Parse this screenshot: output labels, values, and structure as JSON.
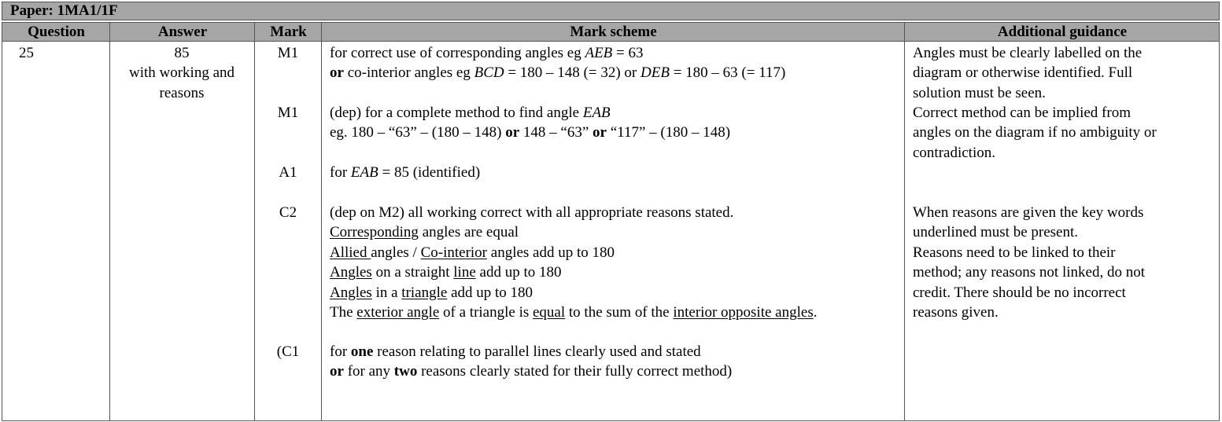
{
  "paper": {
    "label": "Paper: 1MA1/1F"
  },
  "headers": {
    "question": "Question",
    "answer": "Answer",
    "mark": "Mark",
    "mark_scheme": "Mark scheme",
    "additional_guidance": "Additional guidance"
  },
  "row": {
    "question": "25",
    "answer": [
      "85",
      "with working and",
      "reasons"
    ],
    "marks": {
      "m1a": "M1",
      "m1b": "M1",
      "a1": "A1",
      "c2": "C2",
      "c1": "(C1"
    },
    "scheme": {
      "m1a_line1_pre": "for correct use of corresponding angles eg ",
      "m1a_line1_var": "AEB",
      "m1a_line1_post": " = 63",
      "m1a_line2_bold": "or",
      "m1a_line2_a": " co-interior angles eg ",
      "m1a_line2_var1": "BCD",
      "m1a_line2_b": " = 180 – 148 (= 32) or ",
      "m1a_line2_var2": "DEB",
      "m1a_line2_c": " = 180 – 63 (= 117)",
      "m1b_line1_pre": "(dep) for a complete method to find angle ",
      "m1b_line1_var": "EAB",
      "m1b_line2_a": "eg. 180 – “63” – (180 – 148) ",
      "m1b_line2_or1": "or",
      "m1b_line2_b": " 148 – “63” ",
      "m1b_line2_or2": "or",
      "m1b_line2_c": " “117” – (180 – 148)",
      "a1_pre": "for ",
      "a1_var": "EAB",
      "a1_post": " = 85 (identified)",
      "c2_line1": "(dep on M2) all working correct with all appropriate reasons stated.",
      "r1_u": "Corresponding",
      "r1_rest": " angles are equal",
      "r2_u1": "Allied ",
      "r2_mid": "angles / ",
      "r2_u2": "Co-interior",
      "r2_rest": " angles add up to 180",
      "r3_u1": "Angles",
      "r3_mid": " on a straight ",
      "r3_u2": "line",
      "r3_rest": " add up to 180",
      "r4_u1": "Angles",
      "r4_mid": " in a ",
      "r4_u2": "triangle",
      "r4_rest": " add up to 180",
      "r5_a": "The ",
      "r5_u1": "exterior angle",
      "r5_b": " of a triangle is ",
      "r5_u2": "equal",
      "r5_c": " to the sum of the ",
      "r5_u3": "interior opposite angles",
      "r5_d": ".",
      "c1_line1_a": "for ",
      "c1_line1_bold": "one",
      "c1_line1_b": " reason relating to parallel lines clearly used and stated",
      "c1_line2_bold1": "or",
      "c1_line2_a": " for any ",
      "c1_line2_bold2": "two",
      "c1_line2_b": " reasons clearly stated for their fully correct method)"
    },
    "guidance": {
      "g1": "Angles must be clearly labelled on the",
      "g2": "diagram or otherwise identified.  Full",
      "g3": "solution must be seen.",
      "g4": "Correct method can be implied from",
      "g5": "angles on the diagram if no ambiguity or",
      "g6": "contradiction.",
      "g7": "When reasons are given the key words",
      "g8": "underlined must be present.",
      "g9": "Reasons need to be linked to their",
      "g10": "method; any reasons not linked, do not",
      "g11": "credit.  There should be no incorrect",
      "g12": "reasons given."
    }
  }
}
